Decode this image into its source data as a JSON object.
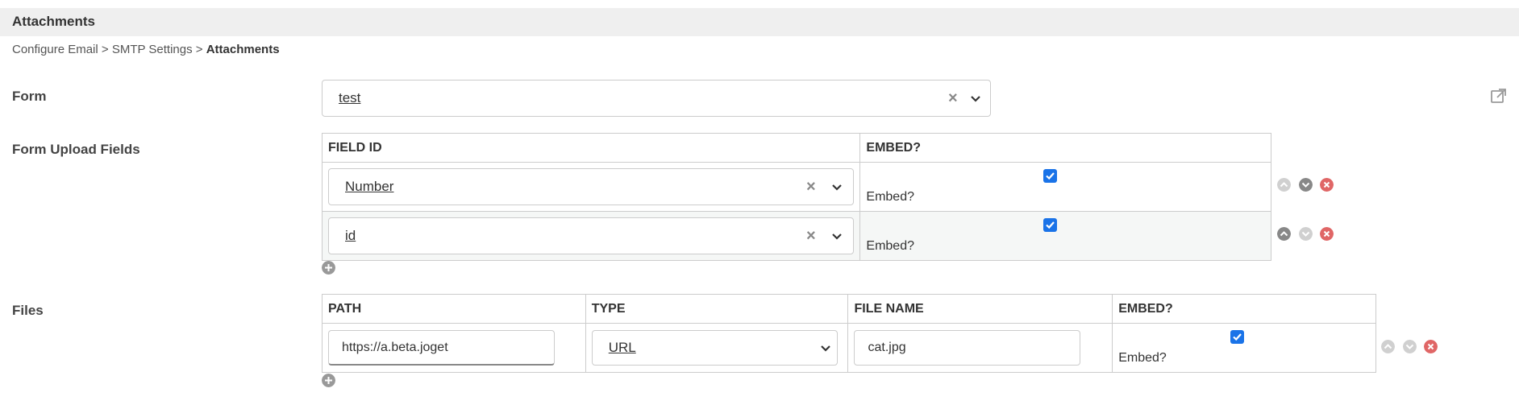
{
  "header": {
    "title": "Attachments"
  },
  "breadcrumb": {
    "item1": "Configure Email",
    "sep1": " > ",
    "item2": "SMTP Settings",
    "sep2": " > ",
    "current": "Attachments"
  },
  "form_row": {
    "label": "Form",
    "selected": "test"
  },
  "upload_fields": {
    "label": "Form Upload Fields",
    "headers": {
      "field_id": "FIELD ID",
      "embed": "EMBED?"
    },
    "rows": [
      {
        "field": "Number",
        "embed_checked": true,
        "embed_label": "Embed?"
      },
      {
        "field": "id",
        "embed_checked": true,
        "embed_label": "Embed?"
      }
    ]
  },
  "files": {
    "label": "Files",
    "headers": {
      "path": "PATH",
      "type": "TYPE",
      "file_name": "FILE NAME",
      "embed": "EMBED?"
    },
    "rows": [
      {
        "path": "https://a.beta.joget",
        "type": "URL",
        "file_name": "cat.jpg",
        "embed_checked": true,
        "embed_label": "Embed?"
      }
    ]
  },
  "icons": {
    "clear": "×",
    "external_link": "external-link-icon",
    "move_up": "move-up-icon",
    "move_down": "move-down-icon",
    "delete": "delete-icon",
    "add": "add-icon"
  },
  "colors": {
    "checkbox": "#1a73e8",
    "delete": "#e06666",
    "action_active": "#888888",
    "action_inactive": "#d0d0d0"
  }
}
